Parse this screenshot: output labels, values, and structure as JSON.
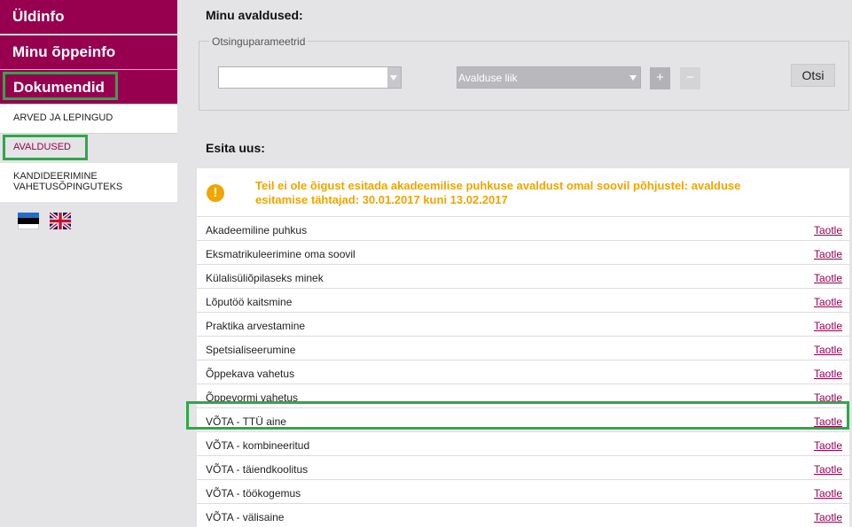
{
  "sidebar": {
    "main_nav": [
      "Üldinfo",
      "Minu õppeinfo",
      "Dokumendid"
    ],
    "sub_nav": [
      "ARVED JA LEPINGUD",
      "AVALDUSED",
      "KANDIDEERIMINE VAHETUSÕPINGUTEKS"
    ],
    "flags": [
      "estonian-flag",
      "uk-flag"
    ]
  },
  "page": {
    "title": "Minu avaldused:",
    "search": {
      "legend": "Otsinguparameetrid",
      "select_1_value": "",
      "select_2_value": "Avalduse liik",
      "plus_label": "+",
      "minus_label": "−",
      "button_label": "Otsi"
    },
    "section_title": "Esita uus:",
    "warning": "Teil ei ole õigust esitada akadeemilise puhkuse avaldust omal soovil põhjustel: avalduse esitamise tähtajad: 30.01.2017 kuni 13.02.2017",
    "apply_label": "Taotle",
    "rows": [
      "Akadeemiline puhkus",
      "Eksmatrikuleerimine oma soovil",
      "Külalisüliõpilaseks minek",
      "Lõputöö kaitsmine",
      "Praktika arvestamine",
      "Spetsialiseerumine",
      "Õppekava vahetus",
      "Õppevormi vahetus",
      "VÕTA - TTÜ aine",
      "VÕTA - kombineeritud",
      "VÕTA - täiendkoolitus",
      "VÕTA - töökogemus",
      "VÕTA - välisaine"
    ]
  },
  "colors": {
    "brand": "#96004f",
    "warning": "#f0a500",
    "highlight": "#2ea84a"
  }
}
